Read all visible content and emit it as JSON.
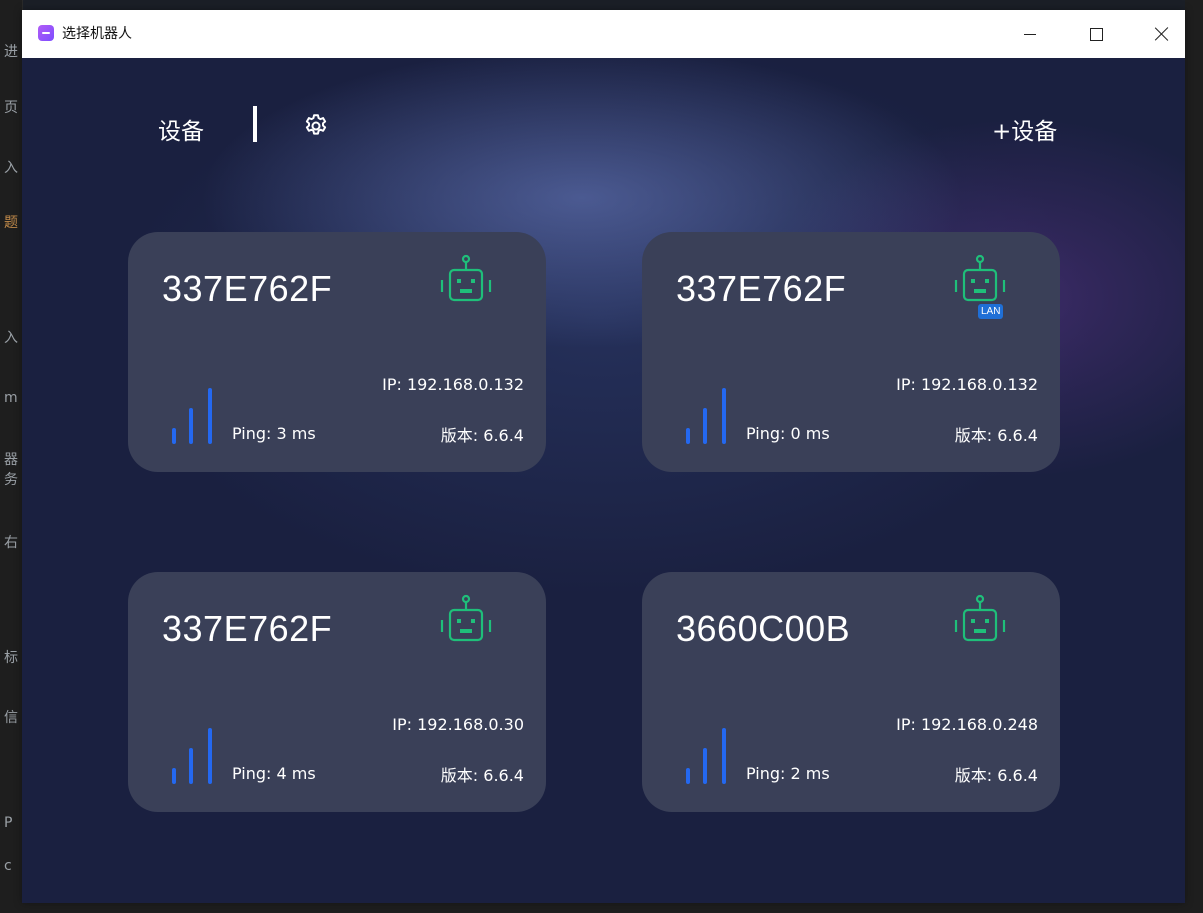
{
  "window": {
    "title": "选择机器人"
  },
  "header": {
    "tab_label": "设备",
    "add_device_label": "+设备"
  },
  "devices": [
    {
      "name": "337E762F",
      "ip": "IP: 192.168.0.132",
      "version": "版本: 6.6.4",
      "ping": "Ping: 3 ms",
      "lan": false,
      "icon": "robot-icon"
    },
    {
      "name": "337E762F",
      "ip": "IP: 192.168.0.132",
      "version": "版本: 6.6.4",
      "ping": "Ping: 0 ms",
      "lan": true,
      "lan_label": "LAN",
      "icon": "robot-icon"
    },
    {
      "name": "337E762F",
      "ip": "IP: 192.168.0.30",
      "version": "版本: 6.6.4",
      "ping": "Ping: 4 ms",
      "lan": false,
      "icon": "robot-icon"
    },
    {
      "name": "3660C00B",
      "ip": "IP: 192.168.0.248",
      "version": "版本: 6.6.4",
      "ping": "Ping: 2 ms",
      "lan": false,
      "icon": "robot-icon"
    }
  ],
  "colors": {
    "card_bg": "#3a4058",
    "robot_green": "#1fbf7a",
    "signal_blue": "#2468f0",
    "lan_blue": "#1f6fd6",
    "app_icon": "#9b59f0"
  }
}
